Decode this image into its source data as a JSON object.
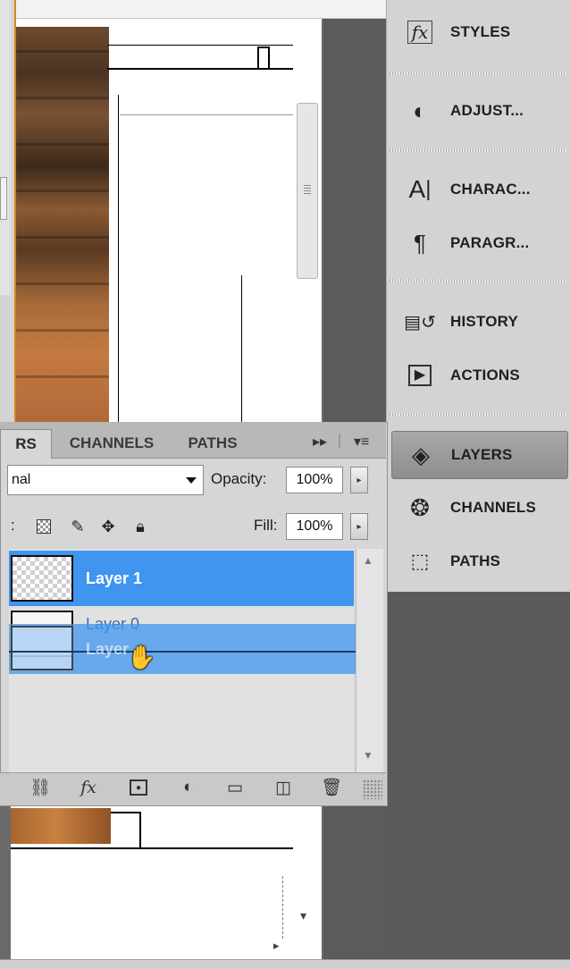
{
  "layers_panel": {
    "tabs": [
      "RS",
      "CHANNELS",
      "PATHS"
    ],
    "blend_mode": "nal",
    "opacity_label": "Opacity:",
    "opacity_value": "100%",
    "fill_label": "Fill:",
    "fill_value": "100%",
    "lock_prefix": ":",
    "layers": [
      {
        "name": "Layer 1",
        "selected": true
      },
      {
        "name": "Layer 0",
        "selected": false
      }
    ],
    "drag_ghost_label": "Layer"
  },
  "dock": {
    "items": [
      {
        "label": "STYLES",
        "icon": "fx-styles-icon"
      },
      {
        "label": "ADJUST...",
        "icon": "adjustments-icon"
      },
      {
        "label": "CHARAC...",
        "icon": "character-icon"
      },
      {
        "label": "PARAGR...",
        "icon": "paragraph-icon"
      },
      {
        "label": "HISTORY",
        "icon": "history-icon"
      },
      {
        "label": "ACTIONS",
        "icon": "actions-icon"
      },
      {
        "label": "LAYERS",
        "icon": "layers-icon",
        "active": true
      },
      {
        "label": "CHANNELS",
        "icon": "channels-icon"
      },
      {
        "label": "PATHS",
        "icon": "paths-icon"
      }
    ]
  },
  "colors": {
    "selection_blue": "#3f95f0",
    "panel_gray": "#d6d6d6",
    "dock_gray": "#d3d3d3",
    "accent_orange": "#d9821f"
  }
}
